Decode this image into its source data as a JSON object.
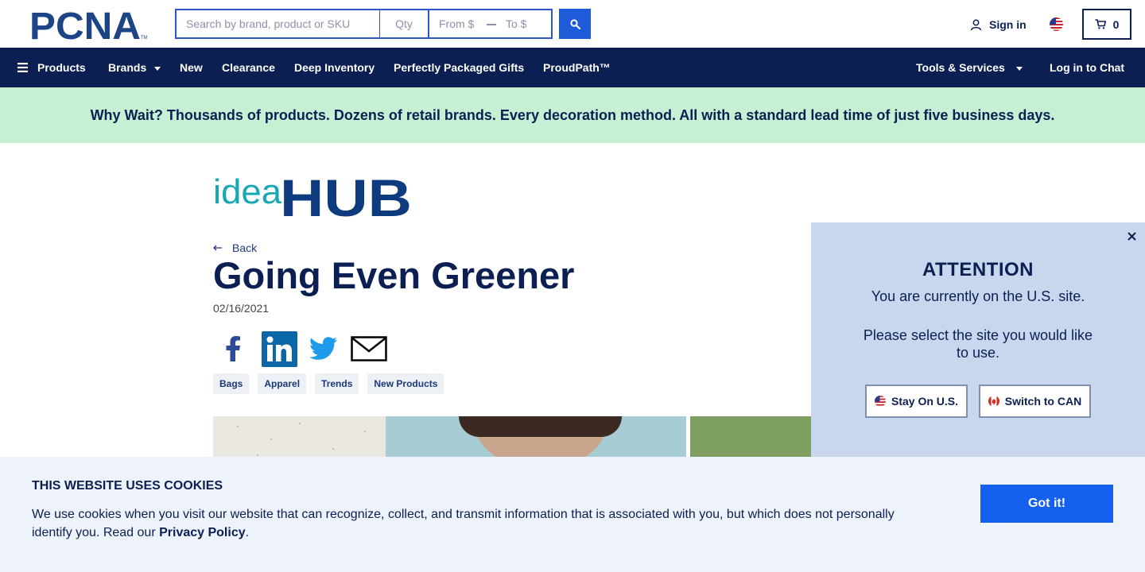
{
  "header": {
    "logo_text": "PCNA",
    "search": {
      "placeholder": "Search by brand, product or SKU",
      "qty_placeholder": "Qty",
      "from_placeholder": "From $",
      "to_placeholder": "To $",
      "button_icon": "search-icon"
    },
    "sign_in_label": "Sign in",
    "locale_icon": "us-flag-icon",
    "cart_count": "0"
  },
  "nav": {
    "products_label": "Products",
    "brands_label": "Brands",
    "new_label": "New",
    "clearance_label": "Clearance",
    "deep_inventory_label": "Deep Inventory",
    "gifts_label": "Perfectly Packaged Gifts",
    "proudpath_label": "ProudPath™",
    "tools_label": "Tools & Services",
    "chat_label": "Log in to Chat"
  },
  "banner": {
    "text": "Why Wait? Thousands of products. Dozens of retail brands. Every decoration method. All with a standard lead time of just five business days."
  },
  "article": {
    "brand_logo": {
      "idea": "idea",
      "hub": "HUB"
    },
    "back_label": "Back",
    "title": "Going Even Greener",
    "date": "02/16/2021",
    "share_icons": [
      "facebook-icon",
      "linkedin-icon",
      "twitter-icon",
      "email-icon"
    ],
    "tags": [
      "Bags",
      "Apparel",
      "Trends",
      "New Products"
    ]
  },
  "attention": {
    "heading": "ATTENTION",
    "message": "You are currently on the U.S. site.",
    "prompt": "Please select the site you would like to use.",
    "stay_label": "Stay On U.S.",
    "switch_label": "Switch to CAN"
  },
  "cookie": {
    "heading": "THIS WEBSITE USES COOKIES",
    "text": "We use cookies when you visit our website that can recognize, collect, and transmit information that is associated with you, but which does not personally identify you. Read our",
    "link_label": "Privacy Policy",
    "period": ".",
    "button_label": "Got it!"
  },
  "colors": {
    "navy": "#0b1f52",
    "accent_blue": "#1e5bd8",
    "banner_green": "#c6efd3",
    "popup_bg": "#c8d7ee",
    "cookie_bg": "#edf2fb",
    "gotit_blue": "#1660f0"
  }
}
